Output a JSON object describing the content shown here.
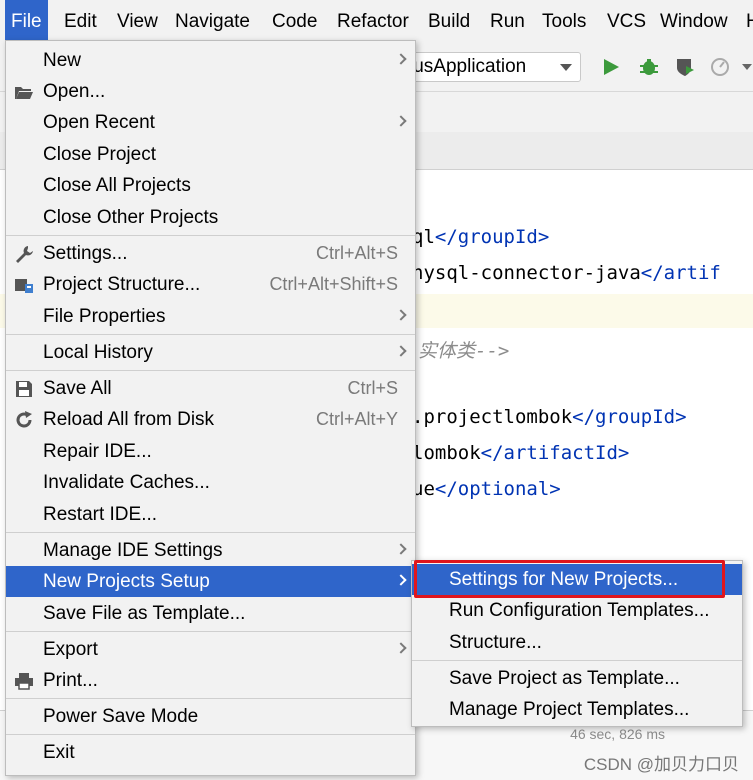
{
  "menubar": {
    "items": [
      "File",
      "Edit",
      "View",
      "Navigate",
      "Code",
      "Refactor",
      "Build",
      "Run",
      "Tools",
      "VCS",
      "Window",
      "H"
    ]
  },
  "toolbar": {
    "run_config": "lusApplication"
  },
  "editor": {
    "lines": [
      {
        "pre": "ql",
        "open": "</",
        "tag": "groupId",
        "close": ">"
      },
      {
        "pre": "nysql-connector-java",
        "open": "</",
        "tag": "artif",
        "close": ""
      },
      {
        "comment": "实体类-->"
      },
      {
        "pre": ".projectlombok",
        "open": "</",
        "tag": "groupId",
        "close": ">"
      },
      {
        "pre": "lombok",
        "open": "</",
        "tag": "artifactId",
        "close": ">"
      },
      {
        "pre": "ue",
        "open": "</",
        "tag": "optional",
        "close": ">"
      }
    ],
    "timing": "46 sec, 826 ms",
    "watermark": "CSDN @加贝力口贝"
  },
  "file_menu": {
    "items": [
      {
        "label": "New",
        "shortcut": "",
        "submenu": true
      },
      {
        "label": "Open...",
        "shortcut": "",
        "submenu": false,
        "icon": "folder-open-icon"
      },
      {
        "label": "Open Recent",
        "shortcut": "",
        "submenu": true
      },
      {
        "label": "Close Project",
        "shortcut": "",
        "submenu": false
      },
      {
        "label": "Close All Projects",
        "shortcut": "",
        "submenu": false
      },
      {
        "label": "Close Other Projects",
        "shortcut": "",
        "submenu": false
      },
      {
        "label": "Settings...",
        "shortcut": "Ctrl+Alt+S",
        "submenu": false,
        "icon": "wrench-icon"
      },
      {
        "label": "Project Structure...",
        "shortcut": "Ctrl+Alt+Shift+S",
        "submenu": false,
        "icon": "project-structure-icon"
      },
      {
        "label": "File Properties",
        "shortcut": "",
        "submenu": true
      },
      {
        "label": "Local History",
        "shortcut": "",
        "submenu": true
      },
      {
        "label": "Save All",
        "shortcut": "Ctrl+S",
        "submenu": false,
        "icon": "save-icon"
      },
      {
        "label": "Reload All from Disk",
        "shortcut": "Ctrl+Alt+Y",
        "submenu": false,
        "icon": "reload-icon"
      },
      {
        "label": "Repair IDE...",
        "shortcut": "",
        "submenu": false
      },
      {
        "label": "Invalidate Caches...",
        "shortcut": "",
        "submenu": false
      },
      {
        "label": "Restart IDE...",
        "shortcut": "",
        "submenu": false
      },
      {
        "label": "Manage IDE Settings",
        "shortcut": "",
        "submenu": true
      },
      {
        "label": "New Projects Setup",
        "shortcut": "",
        "submenu": true,
        "active": true
      },
      {
        "label": "Save File as Template...",
        "shortcut": "",
        "submenu": false
      },
      {
        "label": "Export",
        "shortcut": "",
        "submenu": true
      },
      {
        "label": "Print...",
        "shortcut": "",
        "submenu": false,
        "icon": "print-icon"
      },
      {
        "label": "Power Save Mode",
        "shortcut": "",
        "submenu": false
      },
      {
        "label": "Exit",
        "shortcut": "",
        "submenu": false
      }
    ]
  },
  "submenu": {
    "items": [
      {
        "label": "Settings for New Projects...",
        "active": true
      },
      {
        "label": "Run Configuration Templates..."
      },
      {
        "label": "Structure..."
      },
      {
        "label": "Save Project as Template..."
      },
      {
        "label": "Manage Project Templates..."
      }
    ]
  },
  "colors": {
    "accent": "#2f65ca",
    "highlight_box": "#e0151c",
    "xml_tag": "#0033b3",
    "comment": "#8c8c8c"
  }
}
